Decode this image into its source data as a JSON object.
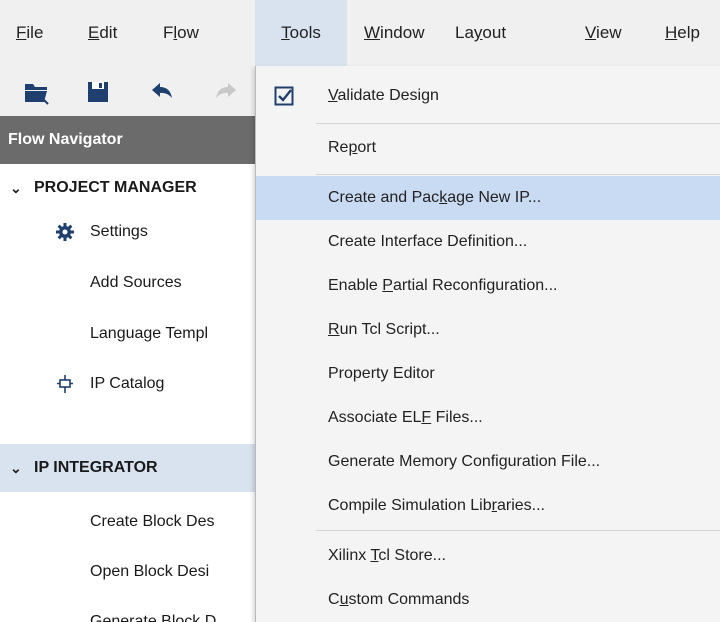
{
  "menubar": {
    "items": [
      {
        "label": "File",
        "mnemonic": "F",
        "rest": "ile"
      },
      {
        "label": "Edit",
        "mnemonic": "E",
        "rest": "dit"
      },
      {
        "label": "Flow",
        "pre": "F",
        "mnemonic": "l",
        "rest": "ow"
      },
      {
        "label": "Tools",
        "mnemonic": "T",
        "rest": "ools"
      },
      {
        "label": "Window",
        "mnemonic": "W",
        "rest": "indow"
      },
      {
        "label": "Layout",
        "pre": "La",
        "mnemonic": "y",
        "rest": "out"
      },
      {
        "label": "View",
        "mnemonic": "V",
        "rest": "iew"
      },
      {
        "label": "Help",
        "mnemonic": "H",
        "rest": "elp"
      }
    ],
    "active": "Tools"
  },
  "toolbar": {
    "icons": [
      "open-project-icon",
      "save-icon",
      "undo-icon",
      "redo-icon"
    ]
  },
  "flow_navigator": {
    "title": "Flow Navigator",
    "project_manager": {
      "label": "PROJECT MANAGER",
      "items": {
        "settings": "Settings",
        "add_sources": "Add Sources",
        "language_templates": "Language Templ",
        "ip_catalog": "IP Catalog"
      }
    },
    "ip_integrator": {
      "label": "IP INTEGRATOR",
      "items": {
        "create_block_design": "Create Block Des",
        "open_block_design": "Open Block Desi",
        "generate_block_design": "Generate Block D"
      }
    }
  },
  "tools_menu": {
    "validate_design": {
      "mnemonic": "V",
      "rest": "alidate Design",
      "checked": true
    },
    "report": {
      "pre": "Re",
      "mnemonic": "p",
      "rest": "ort"
    },
    "create_package_ip": {
      "pre": "Create and Pac",
      "mnemonic": "k",
      "rest": "age New IP..."
    },
    "create_interface": {
      "label": "Create Interface Definition..."
    },
    "enable_partial": {
      "pre": "Enable ",
      "mnemonic": "P",
      "rest": "artial Reconfiguration..."
    },
    "run_tcl": {
      "mnemonic": "R",
      "rest": "un Tcl Script..."
    },
    "property_editor": {
      "label": "Property Editor"
    },
    "associate_elf": {
      "pre": "Associate EL",
      "mnemonic": "F",
      "rest": " Files..."
    },
    "generate_memory": {
      "pre": "Generate Memory Confi",
      "mnemonic": "g",
      "rest": "uration File..."
    },
    "compile_sim": {
      "pre": "Compile Simulation Lib",
      "mnemonic": "r",
      "rest": "aries..."
    },
    "xilinx_tcl_store": {
      "pre": "Xilinx ",
      "mnemonic": "T",
      "rest": "cl Store..."
    },
    "custom_commands": {
      "pre": "C",
      "mnemonic": "u",
      "rest": "stom Commands"
    }
  },
  "colors": {
    "menubar_bg": "#f0f0f0",
    "active_menu_bg": "#d9e3f0",
    "nav_header_bg": "#6b6b6b",
    "hover_bg": "#c9daf3",
    "icon_blue": "#1f3f6e"
  }
}
